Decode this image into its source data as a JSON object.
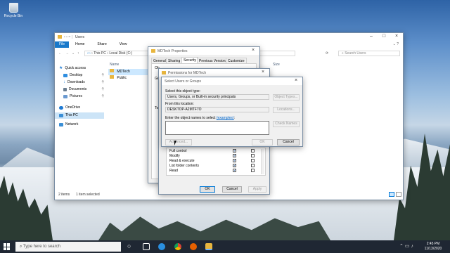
{
  "desktop": {
    "recycle_bin": "Recycle Bin"
  },
  "explorer": {
    "title": "Users",
    "ribbon_tabs": [
      "File",
      "Home",
      "Share",
      "View"
    ],
    "breadcrumb": [
      "This PC",
      "Local Disk (C:)"
    ],
    "search_placeholder": "Search Users",
    "sidebar": [
      {
        "label": "Quick access",
        "icon": "star-icon",
        "color": "#1e7ad3"
      },
      {
        "label": "Desktop",
        "icon": "desktop-icon",
        "color": "#2f8ee0"
      },
      {
        "label": "Downloads",
        "icon": "download-icon",
        "color": "#2f8ee0"
      },
      {
        "label": "Documents",
        "icon": "documents-icon",
        "color": "#6b7e90"
      },
      {
        "label": "Pictures",
        "icon": "pictures-icon",
        "color": "#6b9ad0"
      },
      {
        "label": "OneDrive",
        "icon": "cloud-icon",
        "color": "#1e7ad3"
      },
      {
        "label": "This PC",
        "icon": "computer-icon",
        "color": "#3b8fd6"
      },
      {
        "label": "Network",
        "icon": "network-icon",
        "color": "#3b8fd6"
      }
    ],
    "column_name": "Name",
    "column_size": "Size",
    "files": [
      "MDTech",
      "Public"
    ],
    "status_items": "2 items",
    "status_selected": "1 item selected"
  },
  "properties": {
    "title": "MDTech Properties",
    "tabs": [
      "General",
      "Sharing",
      "Security",
      "Previous Versions",
      "Customize"
    ],
    "active_tab": "Security",
    "obj_label": "Ob",
    "group_label": "Gr",
    "to_label": "To"
  },
  "permissions": {
    "title": "Permissions for MDTech",
    "rows": [
      {
        "name": "Full control",
        "allow": true,
        "deny": false
      },
      {
        "name": "Modify",
        "allow": true,
        "deny": false
      },
      {
        "name": "Read & execute",
        "allow": true,
        "deny": false
      },
      {
        "name": "List folder contents",
        "allow": true,
        "deny": false
      },
      {
        "name": "Read",
        "allow": true,
        "deny": false
      }
    ],
    "ok": "OK",
    "cancel": "Cancel",
    "apply": "Apply"
  },
  "select_users": {
    "title": "Select Users or Groups",
    "object_type_label": "Select this object type:",
    "object_type_value": "Users, Groups, or Built-in security principals",
    "object_types_button": "Object Types...",
    "location_label": "From this location:",
    "location_value": "DESKTOP-A2MTF7O",
    "locations_button": "Locations...",
    "names_label": "Enter the object names to select",
    "examples_link": "(examples)",
    "names_colon": ":",
    "check_names_button": "Check Names",
    "advanced_button": "Advanced...",
    "ok": "OK",
    "cancel": "Cancel"
  },
  "taskbar": {
    "search_placeholder": "Type here to search",
    "time": "2:45 PM",
    "date": "11/13/2020"
  },
  "colors": {
    "accent": "#0078d7",
    "folder": "#e8b63e",
    "taskbar": "#1f2733"
  }
}
